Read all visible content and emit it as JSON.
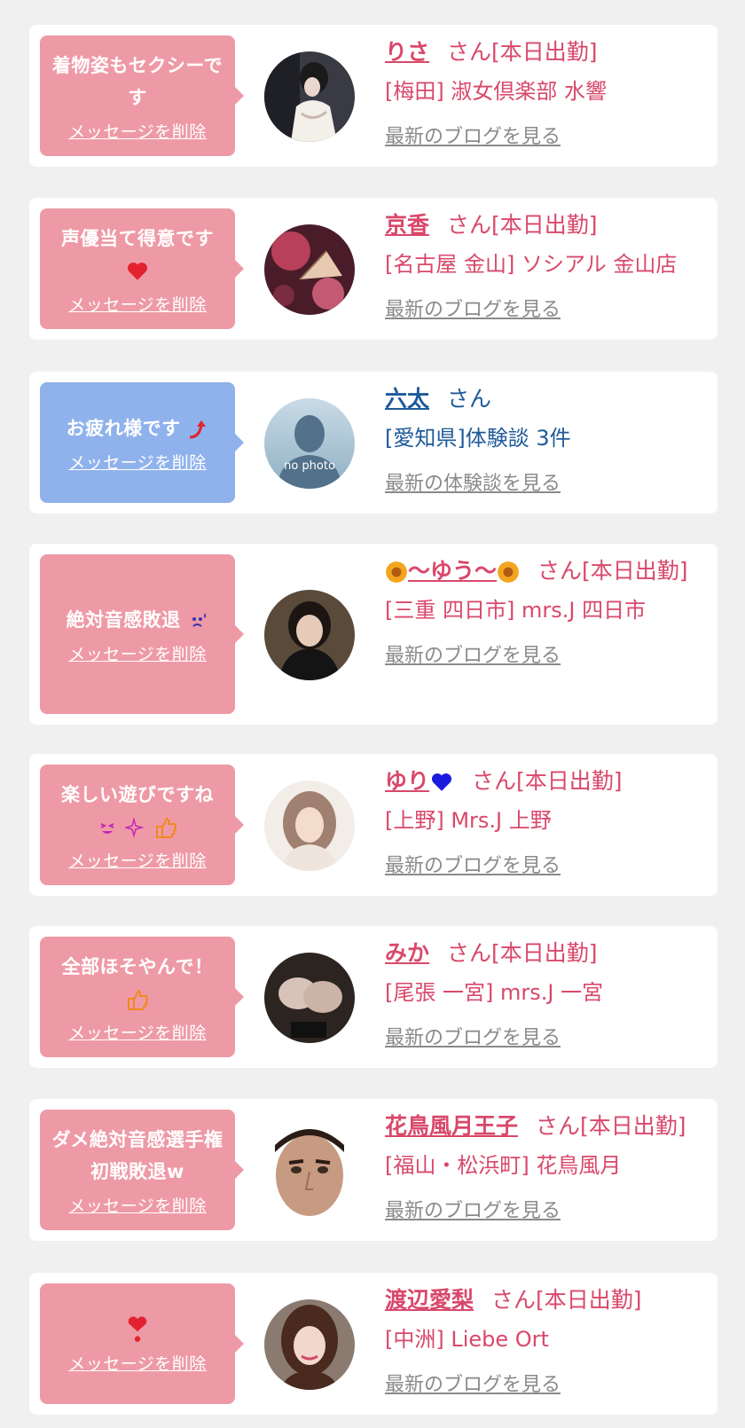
{
  "colors": {
    "pink_bubble": "#ee9aa6",
    "blue_bubble": "#8fb2ec",
    "pink_text": "#d9486a",
    "blue_text": "#1e5a99",
    "link_grey": "#8a8a8a"
  },
  "items": [
    {
      "message": "着物姿もセクシーです",
      "delete_label": "メッセージを削除",
      "name": "りさ",
      "suffix": "さん[本日出勤]",
      "shop": "[梅田] 淑女倶楽部 水響",
      "link": "最新のブログを見る",
      "avatar_icon": "kimono-photo"
    },
    {
      "message": "声優当て得意です",
      "emoji": "heart",
      "delete_label": "メッセージを削除",
      "name": "京香",
      "suffix": "さん[本日出勤]",
      "shop": "[名古屋 金山] ソシアル 金山店",
      "link": "最新のブログを見る",
      "avatar_icon": "fan-photo"
    },
    {
      "message": "お疲れ様です",
      "emoji": "up-arrow",
      "delete_label": "メッセージを削除",
      "name": "六太",
      "suffix": "さん",
      "shop": "[愛知県]体験談 3件",
      "link": "最新の体験談を見る",
      "avatar_text": "no photo"
    },
    {
      "message": "絶対音感敗退",
      "emoji": "sweat-face",
      "delete_label": "メッセージを削除",
      "name": "〜ゆう〜",
      "suffix": "さん[本日出勤]",
      "shop": "[三重 四日市] mrs.J 四日市",
      "link": "最新のブログを見る",
      "avatar_icon": "woman-photo"
    },
    {
      "message": "楽しい遊びですね",
      "delete_label": "メッセージを削除",
      "name": "ゆり",
      "suffix": "さん[本日出勤]",
      "shop": "[上野] Mrs.J 上野",
      "link": "最新のブログを見る",
      "avatar_icon": "woman-photo"
    },
    {
      "message": "全部ほそやんで！",
      "emoji": "thumbs-up",
      "delete_label": "メッセージを削除",
      "name": "みか",
      "suffix": "さん[本日出勤]",
      "shop": "[尾張 一宮] mrs.J 一宮",
      "link": "最新のブログを見る",
      "avatar_icon": "legs-photo"
    },
    {
      "message": "ダメ絶対音感選手権 初戦敗退w",
      "delete_label": "メッセージを削除",
      "name": "花鳥風月王子",
      "suffix": "さん[本日出勤]",
      "shop": "[福山・松浜町] 花鳥風月",
      "link": "最新のブログを見る",
      "avatar_icon": "man-face-photo"
    },
    {
      "message": "",
      "emoji": "heart-exclamation",
      "delete_label": "メッセージを削除",
      "name": "渡辺愛梨",
      "suffix": "さん[本日出勤]",
      "shop": "[中洲] Liebe Ort",
      "link": "最新のブログを見る",
      "avatar_icon": "woman-photo"
    }
  ]
}
